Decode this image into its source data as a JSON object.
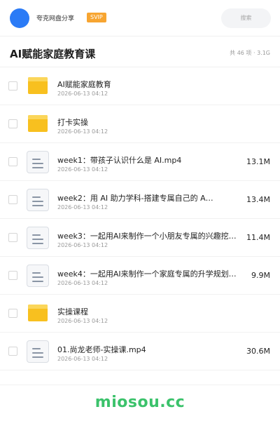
{
  "header": {
    "brand": "夸克网盘分享",
    "badge": "SVIP",
    "search_placeholder": "搜索",
    "avatar_color": "#2b7bf6"
  },
  "folder": {
    "title": "AI赋能家庭教育课",
    "count": "共 46 项 · 3.1G"
  },
  "items": [
    {
      "type": "folder",
      "icon": "folder-icon",
      "name": "AI赋能家庭教育",
      "date": "2026-06-13 04:12",
      "size": ""
    },
    {
      "type": "folder",
      "icon": "folder-icon",
      "name": "打卡实操",
      "date": "2026-06-13 04:12",
      "size": ""
    },
    {
      "type": "file",
      "icon": "file-icon",
      "name": "week1：带孩子认识什么是 AI.mp4",
      "date": "2026-06-13 04:12",
      "size": "13.1M"
    },
    {
      "type": "file",
      "icon": "file-icon",
      "name": "week2：用 AI 助力学科-搭建专属自己的 A…",
      "date": "2026-06-13 04:12",
      "size": "13.4M"
    },
    {
      "type": "file",
      "icon": "file-icon",
      "name": "week3：一起用AI来制作一个小朋友专属的兴趣挖…",
      "date": "2026-06-13 04:12",
      "size": "11.4M"
    },
    {
      "type": "file",
      "icon": "file-icon",
      "name": "week4：一起用AI来制作一个家庭专属的升学规划…",
      "date": "2026-06-13 04:12",
      "size": "9.9M"
    },
    {
      "type": "folder",
      "icon": "folder-icon",
      "name": "实操课程",
      "date": "2026-06-13 04:12",
      "size": ""
    },
    {
      "type": "file",
      "icon": "file-icon",
      "name": "01.尚龙老师-实操课.mp4",
      "date": "2026-06-13 04:12",
      "size": "30.6M"
    }
  ],
  "footer": {
    "watermark": "miosou.cc",
    "watermark_color": "#3bc26b"
  },
  "colors": {
    "folder": "#f8c01f",
    "badge": "#f7a531"
  }
}
